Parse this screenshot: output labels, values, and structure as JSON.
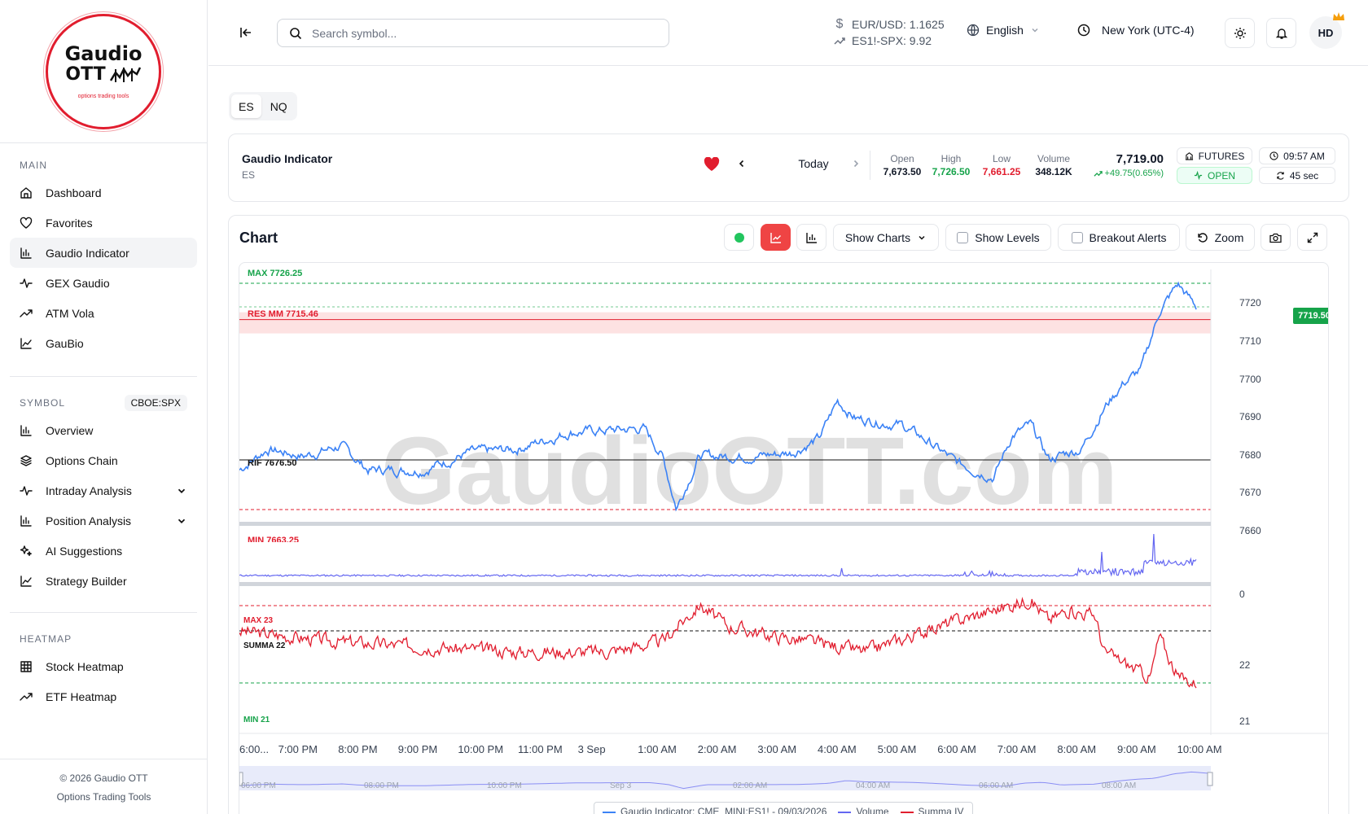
{
  "brand": {
    "line1": "Gaudio",
    "line2": "OTT",
    "tagline": "options trading tools",
    "accent": "#e11d2e"
  },
  "sidebar": {
    "main_title": "MAIN",
    "main_items": [
      {
        "label": "Dashboard",
        "icon": "home-icon"
      },
      {
        "label": "Favorites",
        "icon": "heart-icon"
      },
      {
        "label": "Gaudio Indicator",
        "icon": "bar-chart-icon",
        "active": true
      },
      {
        "label": "GEX Gaudio",
        "icon": "activity-icon"
      },
      {
        "label": "ATM Vola",
        "icon": "trend-icon"
      },
      {
        "label": "GauBio",
        "icon": "chart-line-icon"
      }
    ],
    "symbol_title": "SYMBOL",
    "symbol_badge": "CBOE:SPX",
    "symbol_items": [
      {
        "label": "Overview",
        "icon": "bar-chart-icon"
      },
      {
        "label": "Options Chain",
        "icon": "layers-icon"
      },
      {
        "label": "Intraday Analysis",
        "icon": "activity-icon",
        "expandable": true
      },
      {
        "label": "Position Analysis",
        "icon": "bar-chart-icon",
        "expandable": true
      },
      {
        "label": "AI Suggestions",
        "icon": "sparkles-icon"
      },
      {
        "label": "Strategy Builder",
        "icon": "chart-line-icon"
      }
    ],
    "heatmap_title": "HEATMAP",
    "heatmap_items": [
      {
        "label": "Stock Heatmap",
        "icon": "grid-icon"
      },
      {
        "label": "ETF Heatmap",
        "icon": "trend-icon"
      }
    ],
    "footer_line1": "© 2026 Gaudio OTT",
    "footer_line2": "Options Trading Tools"
  },
  "topbar": {
    "search_placeholder": "Search symbol...",
    "fx1": "EUR/USD: 1.1625",
    "fx2": "ES1!-SPX: 9.92",
    "language": "English",
    "timezone": "New York (UTC-4)",
    "avatar": "HD"
  },
  "symbol_tabs": [
    {
      "label": "ES",
      "active": true
    },
    {
      "label": "NQ",
      "active": false
    }
  ],
  "summary": {
    "title": "Gaudio Indicator",
    "symbol": "ES",
    "date_label": "Today",
    "open_label": "Open",
    "open": "7,673.50",
    "high_label": "High",
    "high": "7,726.50",
    "low_label": "Low",
    "low": "7,661.25",
    "volume_label": "Volume",
    "volume": "348.12K",
    "last": "7,719.00",
    "change": "+49.75(0.65%)",
    "market_type": "FUTURES",
    "status": "OPEN",
    "time": "09:57 AM",
    "refresh": "45 sec",
    "up_color": "#16a34a",
    "down_color": "#e11d2e"
  },
  "toolbar": {
    "title": "Chart",
    "show_charts": "Show Charts",
    "show_levels": "Show Levels",
    "breakout_alerts": "Breakout Alerts",
    "zoom": "Zoom"
  },
  "chart_data": {
    "type": "line",
    "watermark": "GaudioOTT.com",
    "last_price_tag": "7719.50",
    "levels": {
      "max": "MAX 7726.25",
      "res": "RES MM 7715.46",
      "rif": "RIF 7676.50",
      "min": "MIN 7663.25"
    },
    "price_axis": [
      "7720",
      "7710",
      "7700",
      "7690",
      "7680",
      "7670",
      "7660"
    ],
    "volume_axis": [
      "0"
    ],
    "iv_levels": {
      "max": "MAX 23",
      "summa": "SUMMA 22",
      "min": "MIN 21"
    },
    "iv_axis": [
      "22",
      "21"
    ],
    "x_ticks": [
      "6:00...",
      "7:00 PM",
      "8:00 PM",
      "9:00 PM",
      "10:00 PM",
      "11:00 PM",
      "3 Sep",
      "1:00 AM",
      "2:00 AM",
      "3:00 AM",
      "4:00 AM",
      "5:00 AM",
      "6:00 AM",
      "7:00 AM",
      "8:00 AM",
      "9:00 AM",
      "10:00 AM"
    ],
    "navigator_ticks": [
      "06:00 PM",
      "08:00 PM",
      "10:00 PM",
      "Sep 3",
      "02:00 AM",
      "04:00 AM",
      "06:00 AM",
      "08:00 AM"
    ],
    "price_series": {
      "name": "Gaudio Indicator: CME_MINI:ES1! - 09/03/2026",
      "color": "#3b82f6",
      "anchors": [
        [
          0,
          7672
        ],
        [
          0.03,
          7678
        ],
        [
          0.07,
          7676
        ],
        [
          0.11,
          7679
        ],
        [
          0.14,
          7672
        ],
        [
          0.2,
          7672
        ],
        [
          0.25,
          7677
        ],
        [
          0.3,
          7678
        ],
        [
          0.36,
          7683
        ],
        [
          0.44,
          7684
        ],
        [
          0.46,
          7676
        ],
        [
          0.475,
          7661
        ],
        [
          0.49,
          7670
        ],
        [
          0.5,
          7676
        ],
        [
          0.56,
          7676
        ],
        [
          0.6,
          7677
        ],
        [
          0.63,
          7681
        ],
        [
          0.65,
          7692
        ],
        [
          0.67,
          7687
        ],
        [
          0.72,
          7685
        ],
        [
          0.75,
          7680
        ],
        [
          0.78,
          7674
        ],
        [
          0.82,
          7670
        ],
        [
          0.83,
          7676
        ],
        [
          0.84,
          7682
        ],
        [
          0.86,
          7685
        ],
        [
          0.88,
          7675
        ],
        [
          0.9,
          7677
        ],
        [
          0.915,
          7678
        ],
        [
          0.94,
          7690
        ],
        [
          0.96,
          7697
        ],
        [
          0.98,
          7701
        ],
        [
          1.0,
          7718
        ],
        [
          1.02,
          7726
        ],
        [
          1.04,
          7719.5
        ]
      ]
    },
    "volume_series": {
      "name": "Volume",
      "color": "#6366f1"
    },
    "iv_series": {
      "name": "Summa IV",
      "color": "#e11d2e",
      "anchors": [
        [
          0,
          22
        ],
        [
          0.1,
          21.8
        ],
        [
          0.2,
          21.7
        ],
        [
          0.3,
          21.6
        ],
        [
          0.4,
          21.6
        ],
        [
          0.46,
          21.8
        ],
        [
          0.5,
          22.5
        ],
        [
          0.53,
          22.1
        ],
        [
          0.58,
          21.9
        ],
        [
          0.62,
          21.8
        ],
        [
          0.68,
          21.6
        ],
        [
          0.73,
          21.9
        ],
        [
          0.78,
          22.2
        ],
        [
          0.82,
          22.4
        ],
        [
          0.86,
          22.6
        ],
        [
          0.88,
          22.2
        ],
        [
          0.9,
          22.4
        ],
        [
          0.93,
          22.3
        ],
        [
          0.94,
          21.6
        ],
        [
          0.97,
          21.3
        ],
        [
          0.99,
          21.1
        ],
        [
          1.0,
          21.9
        ],
        [
          1.02,
          21.1
        ],
        [
          1.04,
          21.0
        ]
      ]
    }
  }
}
